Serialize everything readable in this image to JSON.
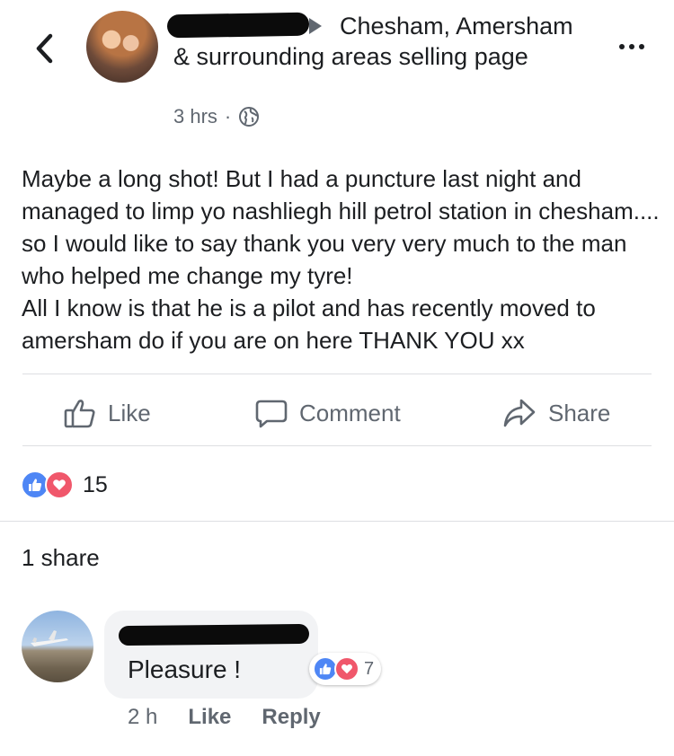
{
  "header": {
    "group_title": "Chesham, Amersham & surrounding areas selling page",
    "time": "3 hrs",
    "separator": "·"
  },
  "post": {
    "text": "Maybe a long shot! But I had a puncture last night and managed to limp yo nashliegh hill petrol station in chesham.... so I would like to say thank you very very much to the man who helped me change my tyre!\nAll I know is that he is a pilot and has recently moved to amersham do if you are on here THANK YOU xx"
  },
  "actions": {
    "like": "Like",
    "comment": "Comment",
    "share": "Share"
  },
  "reactions": {
    "count": "15",
    "icons": [
      "like-icon",
      "love-icon"
    ],
    "colors": {
      "like": "#4e86f5",
      "love": "#f0576b"
    }
  },
  "shares": {
    "label": "1 share"
  },
  "comment": {
    "text": "Pleasure !",
    "reaction_count": "7",
    "time": "2 h",
    "like": "Like",
    "reply": "Reply"
  },
  "colors": {
    "text": "#1c1e21",
    "secondary": "#606770",
    "bubble": "#f2f3f5",
    "divider": "#dddfe2"
  }
}
